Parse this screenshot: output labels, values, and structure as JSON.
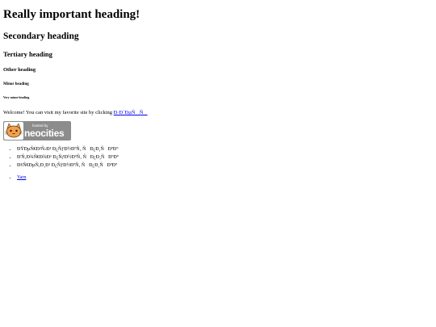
{
  "headings": {
    "h1": "Really important heading!",
    "h2": "Secondary heading",
    "h3": "Tertiary heading",
    "h4": "Other heading",
    "h5": "Minor heading",
    "h6": "Very minor heading"
  },
  "welcome": {
    "text": "Welcome! You can visit my favorite site by clicking ",
    "link_label": "Ð·Ð´ÐµÑÑ"
  },
  "badge": {
    "small_text": "hosted by",
    "big_text": "neocities",
    "icon": "neocities-cat-icon",
    "bg_color": "#8c8c8c"
  },
  "list_items": [
    "ÐŸÐµÑ€Ð²Ñ‹Ð¹ Ð¿ÑƒÐ½ÐºÑ‚ ÑÐ¿Ð¸ÑÐºÐ°",
    "Ð'Ñ‚Ð¾Ñ€Ð¾Ð¹ Ð¿ÑƒÐ½ÐºÑ‚ ÑÐ¿Ð¸ÑÐºÐ°",
    "Ð¢Ñ€ÐµÑ‚Ð¸Ð¹ Ð¿ÑƒÐ½ÐºÑ‚ ÑÐ¿Ð¸ÑÐºÐ°"
  ],
  "links_list": [
    "Yarn"
  ]
}
